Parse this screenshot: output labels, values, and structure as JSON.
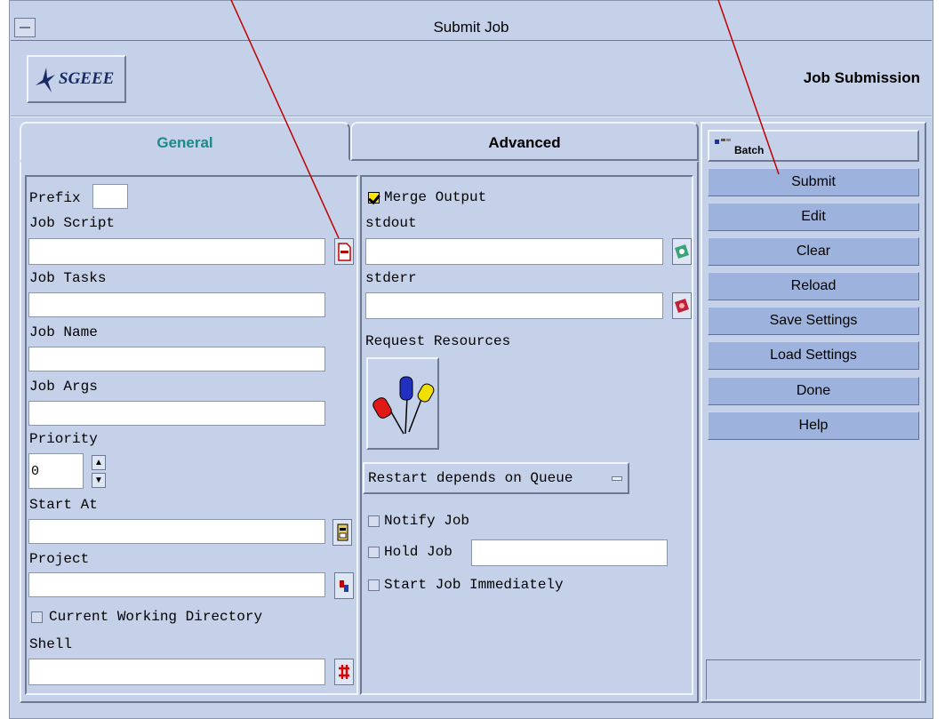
{
  "window": {
    "title": "Submit Job"
  },
  "header": {
    "logo_text": "SGEEE",
    "section_title": "Job Submission"
  },
  "tabs": [
    {
      "label": "General",
      "active": true
    },
    {
      "label": "Advanced",
      "active": false
    }
  ],
  "general": {
    "prefix_label": "Prefix",
    "prefix_value": "",
    "job_script_label": "Job Script",
    "job_script_value": "",
    "job_tasks_label": "Job Tasks",
    "job_tasks_value": "",
    "job_name_label": "Job Name",
    "job_name_value": "",
    "job_args_label": "Job Args",
    "job_args_value": "",
    "priority_label": "Priority",
    "priority_value": "0",
    "start_at_label": "Start At",
    "start_at_value": "",
    "project_label": "Project",
    "project_value": "",
    "cwd_label": "Current Working Directory",
    "shell_label": "Shell",
    "shell_value": ""
  },
  "output": {
    "merge_output_label": "Merge Output",
    "merge_output_checked": true,
    "stdout_label": "stdout",
    "stdout_value": "",
    "stderr_label": "stderr",
    "stderr_value": "",
    "request_resources_label": "Request Resources",
    "restart_label": "Restart depends on Queue",
    "notify_job_label": "Notify Job",
    "hold_job_label": "Hold Job",
    "hold_job_value": "",
    "start_immediately_label": "Start Job Immediately"
  },
  "sidebar": {
    "batch_label": "Batch",
    "buttons": [
      "Submit",
      "Edit",
      "Clear",
      "Reload",
      "Save Settings",
      "Load Settings",
      "Done",
      "Help"
    ]
  },
  "colors": {
    "window_bg": "#c5d1e8",
    "side_button_bg": "#9db3dd",
    "active_tab_text": "#1b8a8a",
    "callout_line": "#c00000"
  },
  "icons": [
    "window-menu-icon",
    "sgeee-logo-icon",
    "script-file-icon",
    "stdout-icon",
    "stderr-icon",
    "resources-icon",
    "calendar-icon",
    "project-icon",
    "shell-icon",
    "batch-icon"
  ]
}
